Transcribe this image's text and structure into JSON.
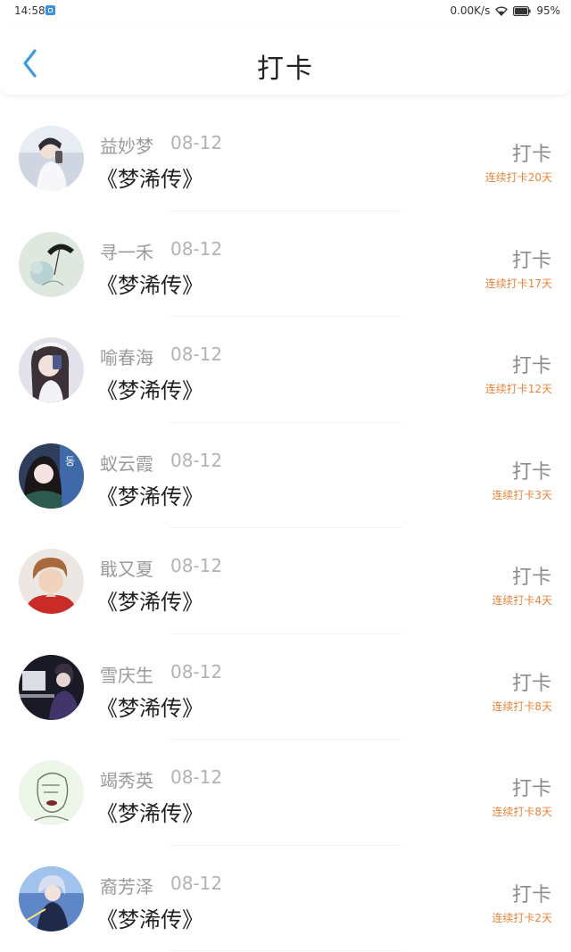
{
  "status_bar": {
    "time": "14:58",
    "network_speed": "0.00K/s",
    "battery": "95%"
  },
  "header": {
    "title": "打卡",
    "back_icon": "chevron-left-icon"
  },
  "colors": {
    "accent": "#3a9be0",
    "streak": "#e8843a"
  },
  "list": [
    {
      "name": "益妙梦",
      "date": "08-12",
      "book": "《梦浠传》",
      "action": "打卡",
      "streak": "连续打卡20天"
    },
    {
      "name": "寻一禾",
      "date": "08-12",
      "book": "《梦浠传》",
      "action": "打卡",
      "streak": "连续打卡17天"
    },
    {
      "name": "喻春海",
      "date": "08-12",
      "book": "《梦浠传》",
      "action": "打卡",
      "streak": "连续打卡12天"
    },
    {
      "name": "蚁云霞",
      "date": "08-12",
      "book": "《梦浠传》",
      "action": "打卡",
      "streak": "连续打卡3天"
    },
    {
      "name": "戢又夏",
      "date": "08-12",
      "book": "《梦浠传》",
      "action": "打卡",
      "streak": "连续打卡4天"
    },
    {
      "name": "雪庆生",
      "date": "08-12",
      "book": "《梦浠传》",
      "action": "打卡",
      "streak": "连续打卡8天"
    },
    {
      "name": "竭秀英",
      "date": "08-12",
      "book": "《梦浠传》",
      "action": "打卡",
      "streak": "连续打卡8天"
    },
    {
      "name": "裔芳泽",
      "date": "08-12",
      "book": "《梦浠传》",
      "action": "打卡",
      "streak": "连续打卡2天"
    }
  ]
}
